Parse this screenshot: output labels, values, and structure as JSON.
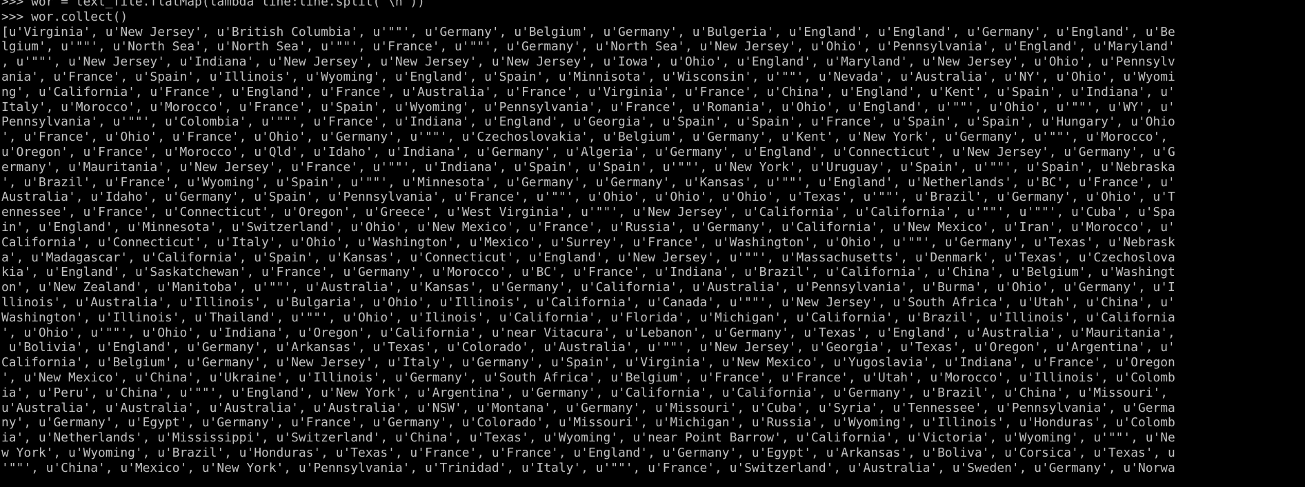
{
  "terminal": {
    "background": "#000000",
    "foreground": "#c0c0c0",
    "lines": [
      ">>> wor = text_file.flatMap(lambda line:line.split(\"\\n\"))",
      ">>> wor.collect()",
      "[u'Virginia', u'New Jersey', u'British Columbia', u'\"\"', u'Germany', u'Belgium', u'Germany', u'Bulgeria', u'England', u'England', u'Germany', u'England', u'Be",
      "lgium', u'\"\"', u'North Sea', u'North Sea', u'\"\"', u'France', u'\"\"', u'Germany', u'North Sea', u'New Jersey', u'Ohio', u'Pennsylvania', u'England', u'Maryland'",
      ", u'\"\"', u'New Jersey', u'Indiana', u'New Jersey', u'New Jersey', u'New Jersey', u'Iowa', u'Ohio', u'England', u'Maryland', u'New Jersey', u'Ohio', u'Pennsylv",
      "ania', u'France', u'Spain', u'Illinois', u'Wyoming', u'England', u'Spain', u'Minnisota', u'Wisconsin', u'\"\"', u'Nevada', u'Australia', u'NY', u'Ohio', u'Wyomi",
      "ng', u'California', u'France', u'England', u'France', u'Australia', u'France', u'Virginia', u'France', u'China', u'England', u'Kent', u'Spain', u'Indiana', u'",
      "Italy', u'Morocco', u'Morocco', u'France', u'Spain', u'Wyoming', u'Pennsylvania', u'France', u'Romania', u'Ohio', u'England', u'\"\"', u'Ohio', u'\"\"', u'WY', u'",
      "Pennsylvania', u'\"\"', u'Colombia', u'\"\"', u'France', u'Indiana', u'England', u'Georgia', u'Spain', u'Spain', u'France', u'Spain', u'Spain', u'Hungary', u'Ohio",
      "', u'France', u'Ohio', u'France', u'Ohio', u'Germany', u'\"\"', u'Czechoslovakia', u'Belgium', u'Germany', u'Kent', u'New York', u'Germany', u'\"\"', u'Morocco',",
      "u'Oregon', u'France', u'Morocco', u'Qld', u'Idaho', u'Indiana', u'Germany', u'Algeria', u'Germany', u'England', u'Connecticut', u'New Jersey', u'Germany', u'G",
      "ermany', u'Mauritania', u'New Jersey', u'France', u'\"\"', u'Indiana', u'Spain', u'Spain', u'\"\"', u'New York', u'Uruguay', u'Spain', u'\"\"', u'Spain', u'Nebraska",
      "', u'Brazil', u'France', u'Wyoming', u'Spain', u'\"\"', u'Minnesota', u'Germany', u'Germany', u'Kansas', u'\"\"', u'England', u'Netherlands', u'BC', u'France', u'",
      "Australia', u'Idaho', u'Germany', u'Spain', u'Pennsylvania', u'France', u'\"\"', u'Ohio', u'Ohio', u'Ohio', u'Texas', u'\"\"', u'Brazil', u'Germany', u'Ohio', u'T",
      "ennessee', u'France', u'Connecticut', u'Oregon', u'Greece', u'West Virginia', u'\"\"', u'New Jersey', u'California', u'California', u'\"\"', u'\"\"', u'Cuba', u'Spa",
      "in', u'England', u'Minnesota', u'Switzerland', u'Ohio', u'New Mexico', u'France', u'Russia', u'Germany', u'California', u'New Mexico', u'Iran', u'Morocco', u'",
      "California', u'Connecticut', u'Italy', u'Ohio', u'Washington', u'Mexico', u'Surrey', u'France', u'Washington', u'Ohio', u'\"\"', u'Germany', u'Texas', u'Nebrask",
      "a', u'Madagascar', u'California', u'Spain', u'Kansas', u'Connecticut', u'England', u'New Jersey', u'\"\"', u'Massachusetts', u'Denmark', u'Texas', u'Czechoslova",
      "kia', u'England', u'Saskatchewan', u'France', u'Germany', u'Morocco', u'BC', u'France', u'Indiana', u'Brazil', u'California', u'China', u'Belgium', u'Washingt",
      "on', u'New Zealand', u'Manitoba', u'\"\"', u'Australia', u'Kansas', u'Germany', u'California', u'Australia', u'Pennsylvania', u'Burma', u'Ohio', u'Germany', u'I",
      "llinois', u'Australia', u'Illinois', u'Bulgaria', u'Ohio', u'Illinois', u'California', u'Canada', u'\"\"', u'New Jersey', u'South Africa', u'Utah', u'China', u'",
      "Washington', u'Illinois', u'Thailand', u'\"\"', u'Ohio', u'Ilinois', u'California', u'Florida', u'Michigan', u'California', u'Brazil', u'Illinois', u'California",
      "', u'Ohio', u'\"\"', u'Ohio', u'Indiana', u'Oregon', u'California', u'near Vitacura', u'Lebanon', u'Germany', u'Texas', u'England', u'Australia', u'Mauritania',",
      " u'Bolivia', u'England', u'Germany', u'Arkansas', u'Texas', u'Colorado', u'Australia', u'\"\"', u'New Jersey', u'Georgia', u'Texas', u'Oregon', u'Argentina', u'",
      "California', u'Belgium', u'Germany', u'New Jersey', u'Italy', u'Germany', u'Spain', u'Virginia', u'New Mexico', u'Yugoslavia', u'Indiana', u'France', u'Oregon",
      "', u'New Mexico', u'China', u'Ukraine', u'Illinois', u'Germany', u'South Africa', u'Belgium', u'France', u'France', u'Utah', u'Morocco', u'Illinois', u'Colomb",
      "ia', u'Peru', u'China', u'\"\"', u'England', u'New York', u'Argentina', u'Germany', u'California', u'California', u'Germany', u'Brazil', u'China', u'Missouri',",
      "u'Australia', u'Australia', u'Australia', u'Australia', u'NSW', u'Montana', u'Germany', u'Missouri', u'Cuba', u'Syria', u'Tennessee', u'Pennsylvania', u'Germa",
      "ny', u'Germany', u'Egypt', u'Germany', u'France', u'Germany', u'Colorado', u'Missouri', u'Michigan', u'Russia', u'Wyoming', u'Illinois', u'Honduras', u'Colomb",
      "ia', u'Netherlands', u'Mississippi', u'Switzerland', u'China', u'Texas', u'Wyoming', u'near Point Barrow', u'California', u'Victoria', u'Wyoming', u'\"\"', u'Ne",
      "w York', u'Wyoming', u'Brazil', u'Honduras', u'Texas', u'France', u'France', u'England', u'Germany', u'Egypt', u'Arkansas', u'Boliva', u'Corsica', u'Texas', u",
      "'\"\"', u'China', u'Mexico', u'New York', u'Pennsylvania', u'Trinidad', u'Italy', u'\"\"', u'France', u'Switzerland', u'Australia', u'Sweden', u'Germany', u'Norwa"
    ]
  }
}
